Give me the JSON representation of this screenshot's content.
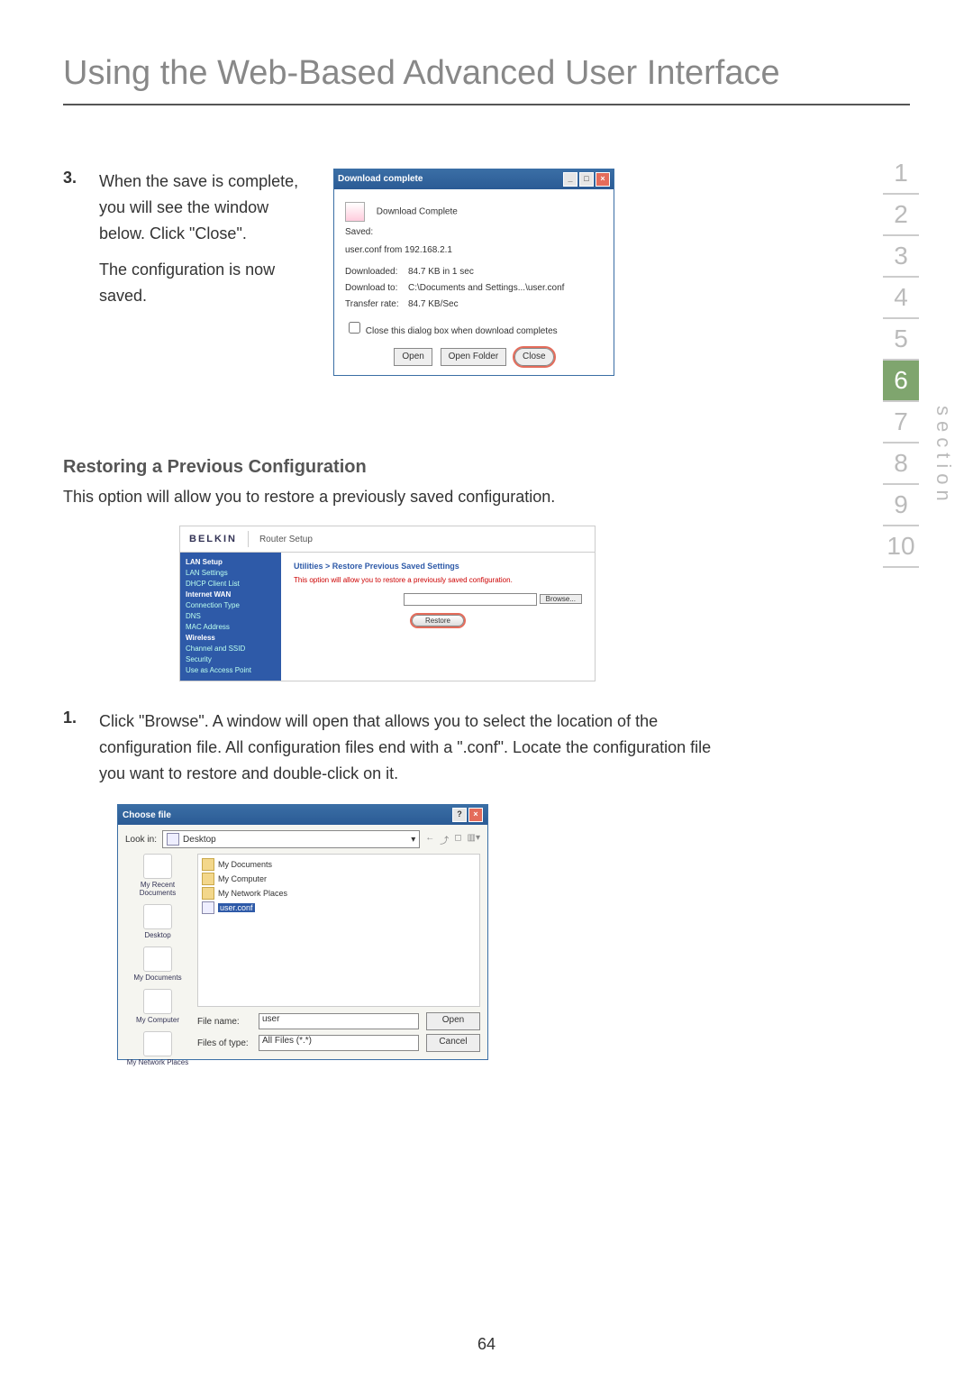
{
  "page_title": "Using the Web-Based Advanced User Interface",
  "section_label": "section",
  "nav": [
    "1",
    "2",
    "3",
    "4",
    "5",
    "6",
    "7",
    "8",
    "9",
    "10"
  ],
  "nav_active": "6",
  "page_number": "64",
  "step3": {
    "num": "3.",
    "text_a": "When the save is complete, you will see the window below. Click \"Close\".",
    "text_b": "The configuration is now saved."
  },
  "dl": {
    "title": "Download complete",
    "heading": "Download Complete",
    "saved_label": "Saved:",
    "saved_value": "user.conf from 192.168.2.1",
    "downloaded_label": "Downloaded:",
    "downloaded_value": "84.7 KB in 1 sec",
    "downloadto_label": "Download to:",
    "downloadto_value": "C:\\Documents and Settings...\\user.conf",
    "rate_label": "Transfer rate:",
    "rate_value": "84.7 KB/Sec",
    "checkbox": "Close this dialog box when download completes",
    "btn_open": "Open",
    "btn_openfolder": "Open Folder",
    "btn_close": "Close"
  },
  "restore": {
    "heading": "Restoring a Previous Configuration",
    "desc": "This option will allow you to restore a previously saved configuration."
  },
  "belkin": {
    "logo": "BELKIN",
    "title": "Router Setup",
    "nav": {
      "lan_setup": "LAN Setup",
      "lan_settings": "LAN Settings",
      "dhcp": "DHCP Client List",
      "wan": "Internet WAN",
      "conn_type": "Connection Type",
      "dns": "DNS",
      "mac": "MAC Address",
      "wireless": "Wireless",
      "channel": "Channel and SSID",
      "security": "Security",
      "use_ap": "Use as Access Point"
    },
    "crumb": "Utilities > Restore Previous Saved Settings",
    "desc": "This option will allow you to restore a previously saved configuration.",
    "browse": "Browse...",
    "restore": "Restore"
  },
  "step1": {
    "num": "1.",
    "text": "Click \"Browse\". A window will open that allows you to select the location of the configuration file. All configuration files end with a \".conf\". Locate the configuration file you want to restore and double-click on it."
  },
  "choose": {
    "title": "Choose file",
    "lookin_label": "Look in:",
    "lookin_value": "Desktop",
    "places": {
      "recent": "My Recent Documents",
      "desktop": "Desktop",
      "mydocs": "My Documents",
      "mycomp": "My Computer",
      "mynet": "My Network Places"
    },
    "files": {
      "mydocs": "My Documents",
      "mycomp": "My Computer",
      "mynet": "My Network Places",
      "userconf": "user.conf"
    },
    "filename_label": "File name:",
    "filename_value": "user",
    "filetype_label": "Files of type:",
    "filetype_value": "All Files (*.*)",
    "open": "Open",
    "cancel": "Cancel"
  }
}
